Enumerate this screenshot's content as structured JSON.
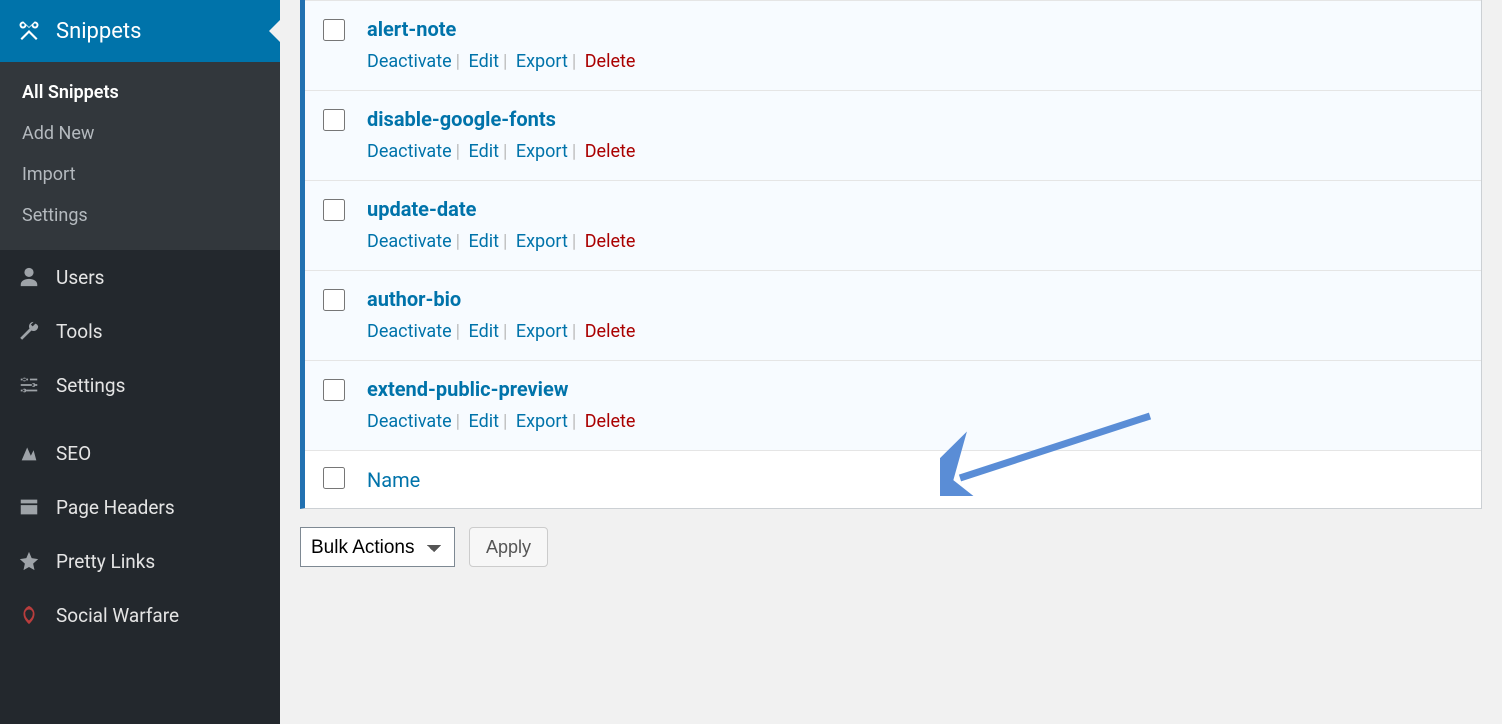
{
  "sidebar": {
    "heading": "Snippets",
    "submenu": [
      {
        "label": "All Snippets",
        "current": true
      },
      {
        "label": "Add New",
        "current": false
      },
      {
        "label": "Import",
        "current": false
      },
      {
        "label": "Settings",
        "current": false
      }
    ],
    "items": [
      {
        "label": "Users"
      },
      {
        "label": "Tools"
      },
      {
        "label": "Settings"
      },
      {
        "label": "SEO"
      },
      {
        "label": "Page Headers"
      },
      {
        "label": "Pretty Links"
      },
      {
        "label": "Social Warfare"
      }
    ]
  },
  "snippets": [
    {
      "title": "alert-note"
    },
    {
      "title": "disable-google-fonts"
    },
    {
      "title": "update-date"
    },
    {
      "title": "author-bio"
    },
    {
      "title": "extend-public-preview"
    }
  ],
  "row_actions": {
    "deactivate": "Deactivate",
    "edit": "Edit",
    "export": "Export",
    "delete": "Delete"
  },
  "footer": {
    "name_column": "Name"
  },
  "bulk": {
    "placeholder": "Bulk Actions",
    "apply": "Apply"
  }
}
